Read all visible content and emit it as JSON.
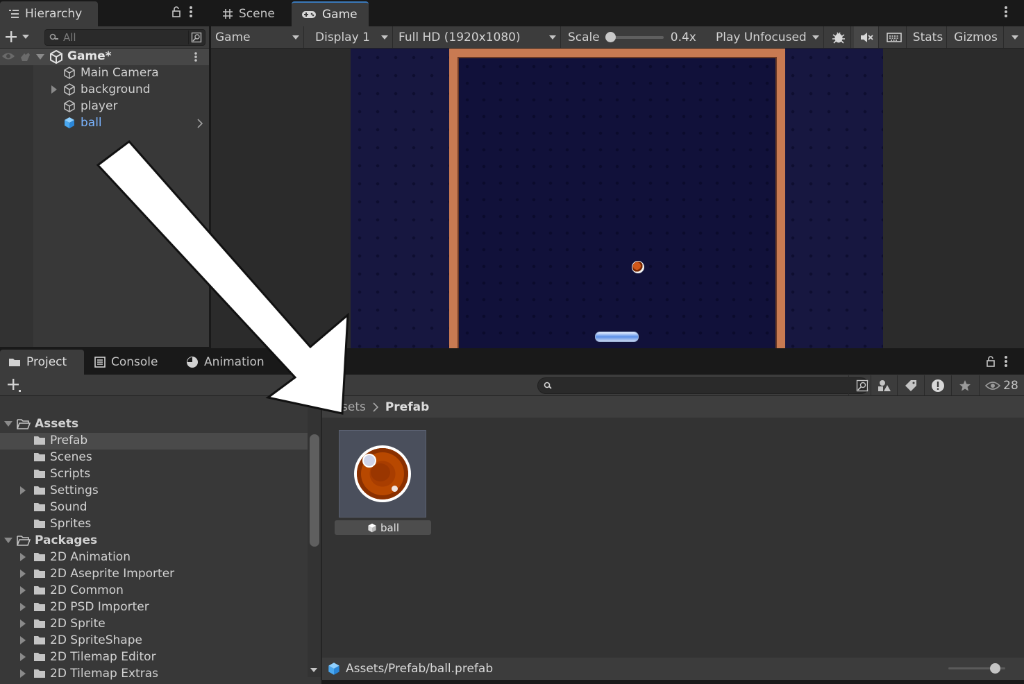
{
  "hierarchy": {
    "tab_label": "Hierarchy",
    "search_placeholder": "All",
    "scene_name": "Game*",
    "items": [
      {
        "label": "Main Camera",
        "expandable": false,
        "selected": false
      },
      {
        "label": "background",
        "expandable": true,
        "selected": false
      },
      {
        "label": "player",
        "expandable": false,
        "selected": false
      },
      {
        "label": "ball",
        "expandable": false,
        "selected": true
      }
    ]
  },
  "game_view": {
    "tabs": [
      {
        "label": "Scene",
        "icon": "grid-icon"
      },
      {
        "label": "Game",
        "icon": "gamepad-icon",
        "active": true
      }
    ],
    "toolbar": {
      "view_select": "Game",
      "display_select": "Display 1",
      "resolution_select": "Full HD (1920x1080)",
      "scale_label": "Scale",
      "scale_value": "0.4x",
      "scale_slider_fraction": 0.0,
      "play_mode_select": "Play Unfocused",
      "stats_label": "Stats",
      "gizmos_label": "Gizmos"
    }
  },
  "project": {
    "tabs": [
      {
        "label": "Project",
        "icon": "folder-icon",
        "active": true
      },
      {
        "label": "Console",
        "icon": "console-icon"
      },
      {
        "label": "Animation",
        "icon": "animation-icon"
      }
    ],
    "hidden_count": "28",
    "breadcrumb": {
      "parent": "sets",
      "current": "Prefab"
    },
    "tree": [
      {
        "label": "Assets",
        "level": 0,
        "expanded": true,
        "bold": true
      },
      {
        "label": "Prefab",
        "level": 1,
        "selected": true
      },
      {
        "label": "Scenes",
        "level": 1
      },
      {
        "label": "Scripts",
        "level": 1
      },
      {
        "label": "Settings",
        "level": 1,
        "expandable": true
      },
      {
        "label": "Sound",
        "level": 1
      },
      {
        "label": "Sprites",
        "level": 1
      },
      {
        "label": "Packages",
        "level": 0,
        "expanded": true,
        "bold": true
      },
      {
        "label": "2D Animation",
        "level": 1,
        "expandable": true
      },
      {
        "label": "2D Aseprite Importer",
        "level": 1,
        "expandable": true
      },
      {
        "label": "2D Common",
        "level": 1,
        "expandable": true
      },
      {
        "label": "2D PSD Importer",
        "level": 1,
        "expandable": true
      },
      {
        "label": "2D Sprite",
        "level": 1,
        "expandable": true
      },
      {
        "label": "2D SpriteShape",
        "level": 1,
        "expandable": true
      },
      {
        "label": "2D Tilemap Editor",
        "level": 1,
        "expandable": true
      },
      {
        "label": "2D Tilemap Extras",
        "level": 1,
        "expandable": true
      }
    ],
    "asset": {
      "label": "ball"
    },
    "status_path": "Assets/Prefab/ball.prefab"
  },
  "colors": {
    "accent": "#3a79bb",
    "selected_text": "#7ab4ff",
    "ball": "#b84800"
  }
}
